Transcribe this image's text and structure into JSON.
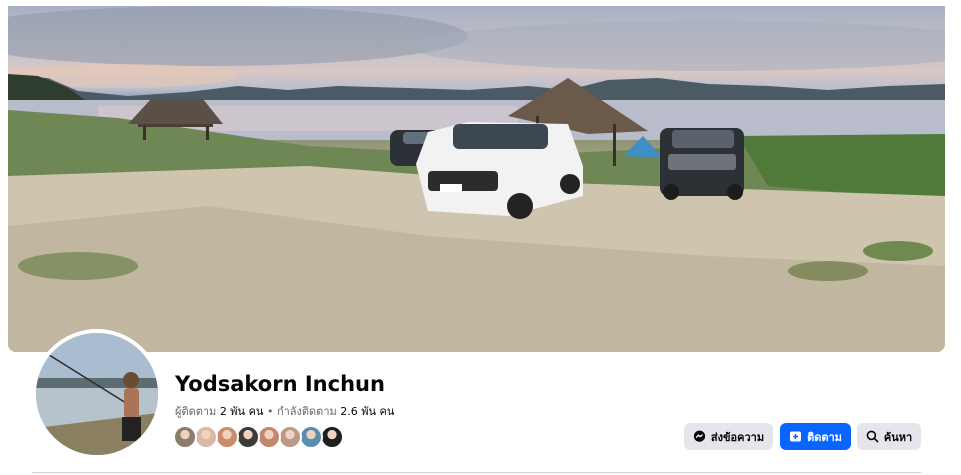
{
  "profile": {
    "name": "Yodsakorn Inchun",
    "stats_followers_label": "ผู้ติดตาม",
    "stats_followers_value": "2 พัน คน",
    "stats_separator": " • ",
    "stats_following_label": "กำลังติดตาม",
    "stats_following_value": "2.6 พัน คน"
  },
  "actions": {
    "message_label": "ส่งข้อความ",
    "follow_label": "ติดตาม",
    "search_label": "ค้นหา"
  },
  "followers_preview": [
    {
      "color": "#8a7d6a"
    },
    {
      "color": "#d9b8a8"
    },
    {
      "color": "#c98d6c"
    },
    {
      "color": "#3b3b3b"
    },
    {
      "color": "#c4866f"
    },
    {
      "color": "#b89a86"
    },
    {
      "color": "#5a8db0"
    },
    {
      "color": "#1f1f1f"
    }
  ],
  "colors": {
    "accent": "#0866ff",
    "secondary_button": "#e4e6eb",
    "muted_text": "#65676b"
  },
  "icons": {
    "message": "messenger-icon",
    "follow": "follow-icon",
    "search": "search-icon"
  }
}
